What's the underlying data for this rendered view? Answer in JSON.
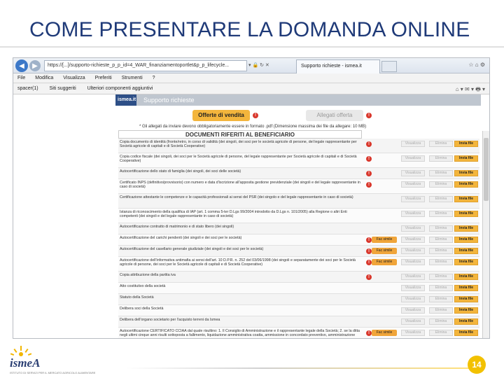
{
  "slide": {
    "title": "COME PRESENTARE LA DOMANDA ONLINE",
    "page_number": "14"
  },
  "browser": {
    "url": "https://[...]/supporto-richieste_p_p_id=4_WAR_finanziamentoportlet&p_p_lifecycle...",
    "tab_title": "Supporto richieste - ismea.it",
    "menu": [
      "File",
      "Modifica",
      "Visualizza",
      "Preferiti",
      "Strumenti",
      "?"
    ],
    "favorites": [
      "spacer(1)",
      "Siti suggeriti",
      "Ulteriori componenti aggiuntivi"
    ]
  },
  "page": {
    "brand_logo": "ismea.it",
    "brand_title": "Supporto richieste",
    "offerte_button": "Offerte di vendita",
    "allegati_button": "Allegati offerta",
    "note": "* Gli allegati da inviare devono obbligatoriamente essere in formato .pdf (Dimensione massima dei file da allegare: 10 MB)",
    "section_title": "DOCUMENTI RIFERITI AL BENEFICIARIO",
    "btn_visualizza": "Visualizza",
    "btn_elimina": "Elimina",
    "btn_invia": "Invia file",
    "btn_facsimile": "Fac simile"
  },
  "documents": [
    {
      "label": "Copia documento di identità (fronte/retro, in corso di validità (dei singoli, dei soci per le società agricole di persone, del legale rappresentante per Società agricole di capitali e di Società Cooperative)",
      "warn": true,
      "facsimile": false
    },
    {
      "label": "Copia codice fiscale (dei singoli, dei soci per le Società agricole di persone, del legale rappresentante per Società agricole di capitali e di Società Cooperative)",
      "warn": true,
      "facsimile": false
    },
    {
      "label": "Autocertificazione dello stato di famiglia (dei singoli, dei soci delle società)",
      "warn": true,
      "facsimile": false
    },
    {
      "label": "Certificato INPS (definitivo/provvisorio) con numero e data d'iscrizione all'apposita gestione previdenziale (dei singoli e del legale rappresentante in caso di società)",
      "warn": true,
      "facsimile": false
    },
    {
      "label": "Certificazione attestante le competenze e le capacità professionali ai sensi del PSR (dei singolo e del legale rappresentante in caso di società)",
      "warn": false,
      "facsimile": false
    },
    {
      "label": "Istanza di riconoscimento della qualifica di IAP (art. 1 comma 5-ter D.Lgs 99/2004 introdotto da D.Lgs n. 101/2005) alla Regione o altri Enti competenti (dei singoli e del legale rappresentante in caso di società)",
      "warn": false,
      "facsimile": false
    },
    {
      "label": "Autocertificazione contratto di matrimonio e di stato libero (dei singoli)",
      "warn": false,
      "facsimile": false
    },
    {
      "label": "Autocertificazione del carichi pendenti (dei singoli e dei soci per le società)",
      "warn": true,
      "facsimile": true
    },
    {
      "label": "Autocertificazione del casellario generale giudiziale (dei singoli e dei soci per le società)",
      "warn": true,
      "facsimile": true
    },
    {
      "label": "Autocertificazione dell'informativa antimafia ai sensi dell'art. 10 D.P.R. n. 252 del 03/06/1998 (dei singoli e separatamente dei soci per le Società agricole di persone, dei soci per le Società agricole di capitali e di Società Cooperative)",
      "warn": true,
      "facsimile": true
    },
    {
      "label": "Copia attribuzione della partita iva",
      "warn": true,
      "facsimile": false
    },
    {
      "label": "Atto costitutivo della società",
      "warn": false,
      "facsimile": false
    },
    {
      "label": "Statuto della Società",
      "warn": false,
      "facsimile": false
    },
    {
      "label": "Delibera soci della Società",
      "warn": false,
      "facsimile": false
    },
    {
      "label": "Delibera dell'organo societario per l'acquisto terreni da Ismea",
      "warn": false,
      "facsimile": false
    },
    {
      "label": "Autocertificazione CERTIFICATO CCIAA dal quale risultino: 1. Il Consiglio di Amministrazione e il rappresentante legale della Società; 2. se la ditta negli ultimi cinque anni risulti sottoposta a fallimento, liquidazione amministrativa coatta, ammissione in concordato preventivo, amministrazione controllata",
      "warn": true,
      "facsimile": true
    }
  ],
  "footer": {
    "logo_text": "ismeA",
    "logo_sub": "ISTITUTO DI SERVIZI PER IL MERCATO AGRICOLO ALIMENTARE"
  }
}
